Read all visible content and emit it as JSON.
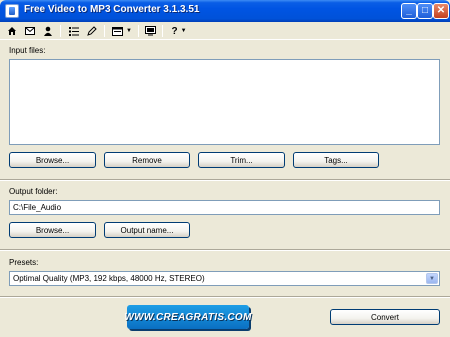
{
  "window": {
    "title": "Free Video to MP3 Converter 3.1.3.51",
    "minimize_glyph": "_",
    "maximize_glyph": "□",
    "close_glyph": "✕"
  },
  "toolbar": {
    "items": [
      "home-icon",
      "mail-icon",
      "user-icon",
      "list-icon",
      "edit-icon",
      "window-menu-icon",
      "monitor-icon",
      "help-icon"
    ],
    "help_glyph": "?",
    "caret": "▼"
  },
  "input_section": {
    "label": "Input files:",
    "buttons": {
      "browse": "Browse...",
      "remove": "Remove",
      "trim": "Trim...",
      "tags": "Tags..."
    }
  },
  "output_section": {
    "label": "Output folder:",
    "path": "C:\\File_Audio",
    "buttons": {
      "browse": "Browse...",
      "output_name": "Output name..."
    }
  },
  "presets": {
    "label": "Presets:",
    "selected": "Optimal Quality (MP3, 192 kbps, 48000 Hz, STEREO)"
  },
  "footer": {
    "banner_text": "WWW.CREAGRATIS.COM",
    "convert_button": "Convert"
  },
  "colors": {
    "titlebar": "#0054e3",
    "window_bg": "#ece9d8",
    "banner": "#0a7fd4"
  }
}
